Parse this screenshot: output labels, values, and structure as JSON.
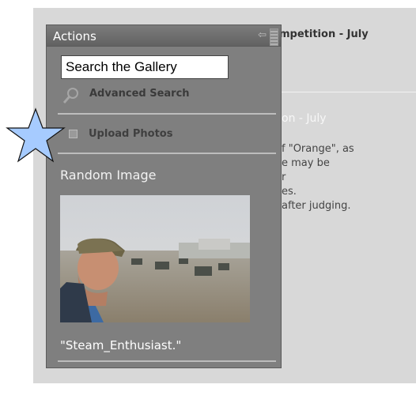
{
  "background": {
    "header": "mpetition - July",
    "subtitle": "on - July",
    "text_lines": [
      "f \"Orange\", as",
      "e may be",
      "r",
      "es.",
      "after judging."
    ]
  },
  "actions": {
    "title": "Actions",
    "search": {
      "value": "Search the Gallery",
      "placeholder": ""
    },
    "advanced_search": "Advanced Search",
    "upload": "Upload Photos",
    "random_image": {
      "title": "Random Image",
      "caption": "\"Steam_Enthusiast.\""
    }
  },
  "colors": {
    "panel": "#7f7f7f",
    "panel_border": "#5c5c5c",
    "title_bar": "#6e6e6e",
    "star_fill": "#a6cbff",
    "page_bg": "#d8d8d8"
  },
  "icons": [
    "star-icon",
    "collapse-arrow-icon",
    "grip-icon",
    "magnifier-icon",
    "upload-icon"
  ]
}
